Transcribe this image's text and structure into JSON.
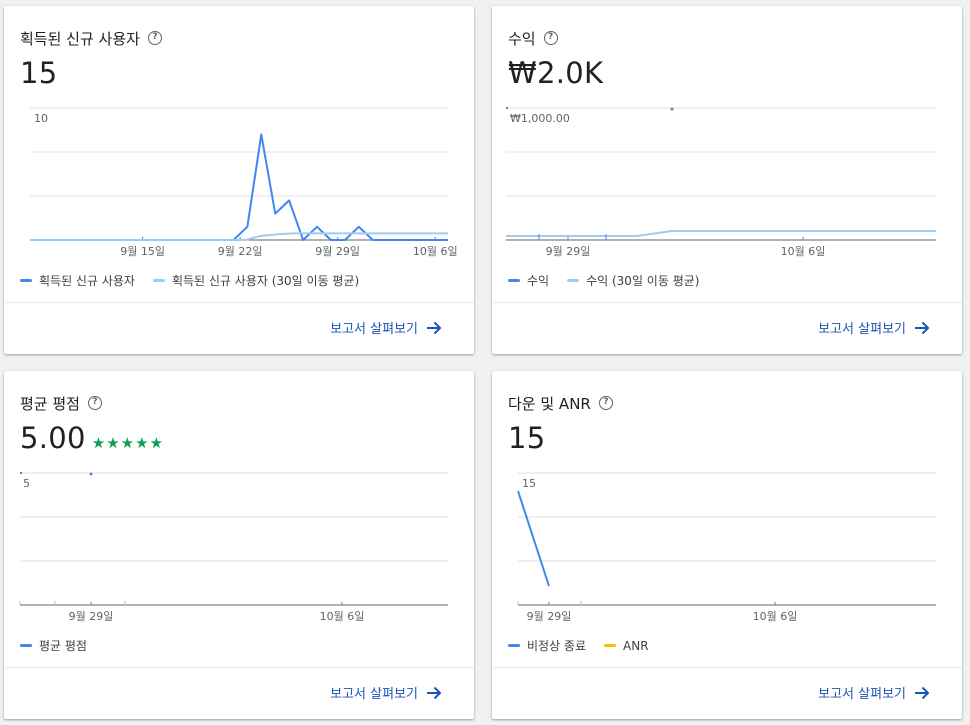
{
  "colors": {
    "primary": "#4285f4",
    "moving_avg": "#9fcbef",
    "anr": "#fbbc04",
    "link": "#1a56b4",
    "stars": "#0f9d58"
  },
  "icons": {
    "help": "help-circle-icon",
    "arrow": "arrow-right-icon"
  },
  "cards": {
    "new_users": {
      "title": "획득된 신규 사용자",
      "value": "15",
      "legend": [
        "획득된 신규 사용자",
        "획득된 신규 사용자 (30일 이동 평균)"
      ],
      "link": "보고서 살펴보기"
    },
    "revenue": {
      "title": "수익",
      "value": "₩2.0K",
      "legend": [
        "수익",
        "수익 (30일 이동 평균)"
      ],
      "link": "보고서 살펴보기"
    },
    "rating": {
      "title": "평균 평점",
      "value": "5.00",
      "stars": "★★★★★",
      "legend": [
        "평균 평점"
      ],
      "link": "보고서 살펴보기"
    },
    "crashes": {
      "title": "다운 및 ANR",
      "value": "15",
      "legend": [
        "비정상 종료",
        "ANR"
      ],
      "link": "보고서 살펴보기"
    }
  },
  "chart_data": [
    {
      "type": "line",
      "ylabel": "",
      "y_tick": "10",
      "ylim": [
        0,
        10
      ],
      "x_ticks": [
        "9월 15일",
        "9월 22일",
        "9월 29일",
        "10월 6일"
      ],
      "x_range": [
        "9월 9일",
        "10월 9일"
      ],
      "series": [
        {
          "name": "획득된 신규 사용자",
          "x": [
            "9월 23일",
            "9월 24일",
            "9월 25일",
            "9월 26일",
            "9월 27일",
            "9월 28일",
            "9월 29일",
            "9월 30일",
            "10월 1일",
            "10월 2일",
            "10월 3일",
            "10월 4일"
          ],
          "values": [
            0,
            1,
            8,
            2,
            3,
            0,
            1,
            0,
            0,
            1,
            0,
            0
          ]
        },
        {
          "name": "획득된 신규 사용자 (30일 이동 평균)",
          "x": [
            "9월 25일",
            "9월 27일",
            "9월 28일",
            "10월 9일"
          ],
          "values": [
            0.3,
            0.45,
            0.5,
            0.5
          ]
        }
      ]
    },
    {
      "type": "line",
      "y_tick": "₩1,000.00",
      "ylim": [
        0,
        1000
      ],
      "x_ticks": [
        "9월 29일",
        "10월 6일"
      ],
      "series": [
        {
          "name": "수익",
          "values": [
            0,
            1000,
            0
          ]
        },
        {
          "name": "수익 (30일 이동 평균)",
          "values": [
            30,
            30,
            30,
            65,
            65,
            65
          ]
        }
      ]
    },
    {
      "type": "line",
      "y_tick": "5",
      "ylim": [
        0,
        5
      ],
      "x_ticks": [
        "9월 29일",
        "10월 6일"
      ],
      "series": [
        {
          "name": "평균 평점",
          "values": [
            5,
            5
          ]
        }
      ]
    },
    {
      "type": "line",
      "y_tick": "15",
      "ylim": [
        0,
        15
      ],
      "x_ticks": [
        "9월 29일",
        "10월 6일"
      ],
      "series": [
        {
          "name": "비정상 종료",
          "values": [
            15,
            0
          ]
        },
        {
          "name": "ANR",
          "values": []
        }
      ]
    }
  ]
}
